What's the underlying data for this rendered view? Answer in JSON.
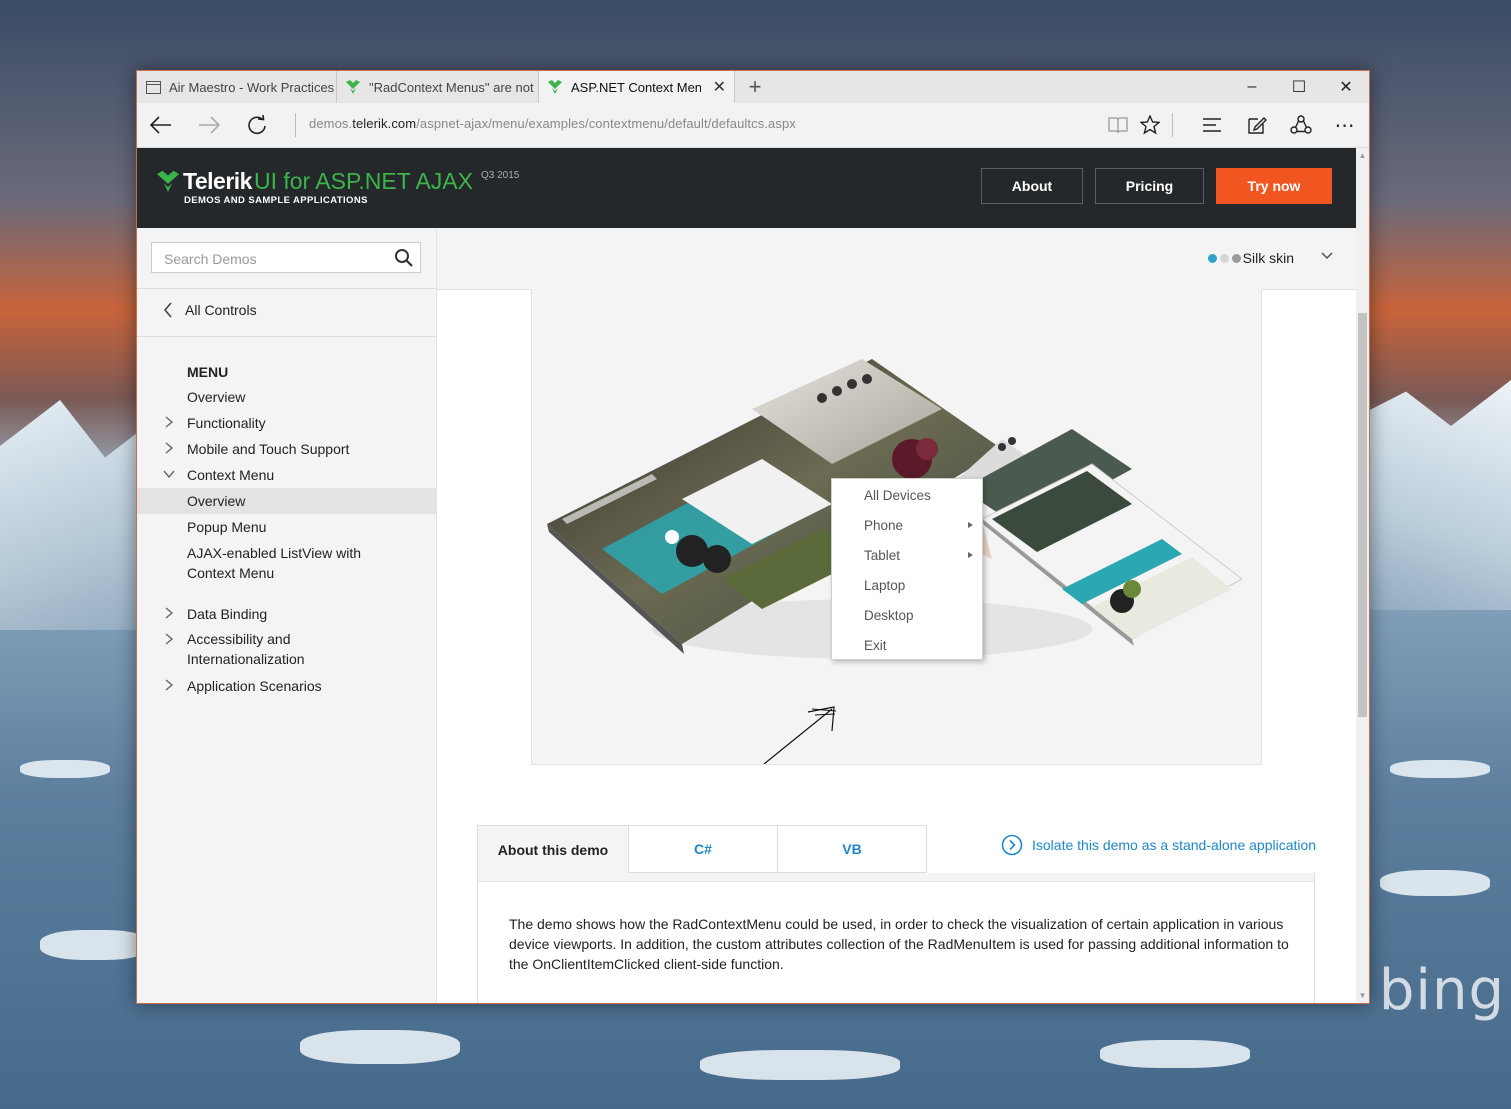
{
  "browser": {
    "tabs": [
      {
        "label": "Air Maestro - Work Practices",
        "icon": "page-icon",
        "active": false
      },
      {
        "label": "\"RadContext Menus\" are not",
        "icon": "telerik-icon",
        "active": false
      },
      {
        "label": "ASP.NET Context Menu",
        "icon": "telerik-icon",
        "active": true
      }
    ],
    "new_tab": "+",
    "window_controls": {
      "minimize": "–",
      "maximize": "☐",
      "close": "✕"
    },
    "url_prefix": "demos.",
    "url_host": "telerik.com",
    "url_path": "/aspnet-ajax/menu/examples/contextmenu/default/defaultcs.aspx"
  },
  "header": {
    "brand": "Telerik",
    "product": "UI for ASP.NET AJAX",
    "version": "Q3 2015",
    "subtitle": "DEMOS AND SAMPLE APPLICATIONS",
    "buttons": {
      "about": "About",
      "pricing": "Pricing",
      "try": "Try now"
    },
    "colors": {
      "bg": "#25282b",
      "green": "#3bb54a",
      "orange": "#f25620"
    }
  },
  "sidebar": {
    "search_placeholder": "Search Demos",
    "all_controls": "All Controls",
    "section": "MENU",
    "items": [
      {
        "label": "Overview",
        "arrow": "none"
      },
      {
        "label": "Functionality",
        "arrow": "right"
      },
      {
        "label": "Mobile and Touch Support",
        "arrow": "right"
      },
      {
        "label": "Context Menu",
        "arrow": "down"
      },
      {
        "label": "Overview",
        "arrow": "none",
        "selected": true
      },
      {
        "label": "Popup Menu",
        "arrow": "none"
      },
      {
        "label": "AJAX-enabled ListView with",
        "label2": "Context Menu",
        "arrow": "none"
      },
      {
        "label": "Data Binding",
        "arrow": "right"
      },
      {
        "label": "Accessibility and",
        "label2": "Internationalization",
        "arrow": "right"
      },
      {
        "label": "Application Scenarios",
        "arrow": "right"
      }
    ]
  },
  "skin": {
    "label": "Silk skin",
    "dot_colors": [
      "#2fa4c8",
      "#d6d6d6",
      "#9a9a9a"
    ]
  },
  "context_menu": {
    "items": [
      {
        "label": "All Devices",
        "submenu": false
      },
      {
        "label": "Phone",
        "submenu": true
      },
      {
        "label": "Tablet",
        "submenu": true
      },
      {
        "label": "Laptop",
        "submenu": false
      },
      {
        "label": "Desktop",
        "submenu": false
      },
      {
        "label": "Exit",
        "submenu": false
      }
    ]
  },
  "demo_tabs": {
    "about": "About this demo",
    "cs": "C#",
    "vb": "VB"
  },
  "isolate_link": "Isolate this demo as a stand-alone application",
  "description": "The demo shows how the RadContextMenu could be used, in order to check the visualization of certain application in various device viewports. In addition, the custom attributes collection of the RadMenuItem is used for passing additional information to the OnClientItemClicked client-side function.",
  "desktop": {
    "watermark": "bing"
  }
}
